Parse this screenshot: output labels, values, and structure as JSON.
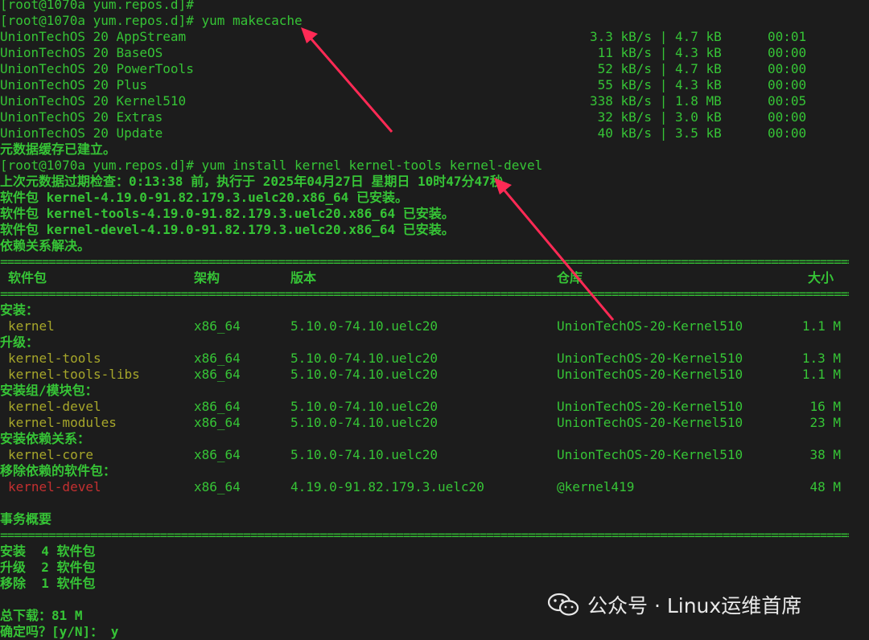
{
  "colors": {
    "background": "#1c1c1c",
    "green": "#36c436",
    "olive": "#a6a62a",
    "red": "#c43030",
    "arrow": "#ff2a55"
  },
  "lines": {
    "prompt_prev": "[root@1070a yum.repos.d]#",
    "cmd_makecache": "[root@1070a yum.repos.d]# yum makecache",
    "cmd_install": "[root@1070a yum.repos.d]# yum install kernel kernel-tools kernel-devel",
    "meta_done": "元数据缓存已建立。",
    "last_check": "上次元数据过期检查：0:13:38 前，执行于 2025年04月27日 星期日 10时47分47秒。",
    "installed": [
      "软件包 kernel-4.19.0-91.82.179.3.uelc20.x86_64 已安装。",
      "软件包 kernel-tools-4.19.0-91.82.179.3.uelc20.x86_64 已安装。",
      "软件包 kernel-devel-4.19.0-91.82.179.3.uelc20.x86_64 已安装。"
    ],
    "deps_resolved": "依赖关系解决。",
    "separator": "===================================================================================================================================================",
    "tx_summary": "事务概要",
    "summary": [
      "安装  4 软件包",
      "升级  2 软件包",
      "移除  1 软件包"
    ],
    "total_download": "总下载：81 M",
    "confirm": "确定吗？[y/N]： y"
  },
  "repos": [
    {
      "name": "UnionTechOS 20 AppStream",
      "speed": "3.3 kB/s | 4.7 kB",
      "time": "00:01"
    },
    {
      "name": "UnionTechOS 20 BaseOS",
      "speed": " 11 kB/s | 4.3 kB",
      "time": "00:00"
    },
    {
      "name": "UnionTechOS 20 PowerTools",
      "speed": " 52 kB/s | 4.7 kB",
      "time": "00:00"
    },
    {
      "name": "UnionTechOS 20 Plus",
      "speed": " 55 kB/s | 4.3 kB",
      "time": "00:00"
    },
    {
      "name": "UnionTechOS 20 Kernel510",
      "speed": "338 kB/s | 1.8 MB",
      "time": "00:05"
    },
    {
      "name": "UnionTechOS 20 Extras",
      "speed": " 32 kB/s | 3.0 kB",
      "time": "00:00"
    },
    {
      "name": "UnionTechOS 20 Update",
      "speed": " 40 kB/s | 3.5 kB",
      "time": "00:00"
    }
  ],
  "table": {
    "headers": {
      "pkg": "软件包",
      "arch": "架构",
      "ver": "版本",
      "repo": "仓库",
      "size": "大小"
    },
    "sections": [
      {
        "title": "安装：",
        "rows": [
          {
            "pkg": "kernel",
            "arch": "x86_64",
            "ver": "5.10.0-74.10.uelc20",
            "repo": "UnionTechOS-20-Kernel510",
            "size": "1.1 M",
            "color": "olive"
          }
        ]
      },
      {
        "title": "升级：",
        "rows": [
          {
            "pkg": "kernel-tools",
            "arch": "x86_64",
            "ver": "5.10.0-74.10.uelc20",
            "repo": "UnionTechOS-20-Kernel510",
            "size": "1.3 M",
            "color": "olive"
          },
          {
            "pkg": "kernel-tools-libs",
            "arch": "x86_64",
            "ver": "5.10.0-74.10.uelc20",
            "repo": "UnionTechOS-20-Kernel510",
            "size": "1.1 M",
            "color": "olive"
          }
        ]
      },
      {
        "title": "安装组/模块包：",
        "rows": [
          {
            "pkg": "kernel-devel",
            "arch": "x86_64",
            "ver": "5.10.0-74.10.uelc20",
            "repo": "UnionTechOS-20-Kernel510",
            "size": "16 M",
            "color": "olive"
          },
          {
            "pkg": "kernel-modules",
            "arch": "x86_64",
            "ver": "5.10.0-74.10.uelc20",
            "repo": "UnionTechOS-20-Kernel510",
            "size": "23 M",
            "color": "olive"
          }
        ]
      },
      {
        "title": "安装依赖关系：",
        "rows": [
          {
            "pkg": "kernel-core",
            "arch": "x86_64",
            "ver": "5.10.0-74.10.uelc20",
            "repo": "UnionTechOS-20-Kernel510",
            "size": "38 M",
            "color": "olive"
          }
        ]
      },
      {
        "title": "移除依赖的软件包：",
        "rows": [
          {
            "pkg": "kernel-devel",
            "arch": "x86_64",
            "ver": "4.19.0-91.82.179.3.uelc20",
            "repo": "@kernel419",
            "size": "48 M",
            "color": "red"
          }
        ]
      }
    ]
  },
  "watermark": {
    "text": "公众号 · Linux运维首席",
    "icon": "wechat-icon"
  }
}
